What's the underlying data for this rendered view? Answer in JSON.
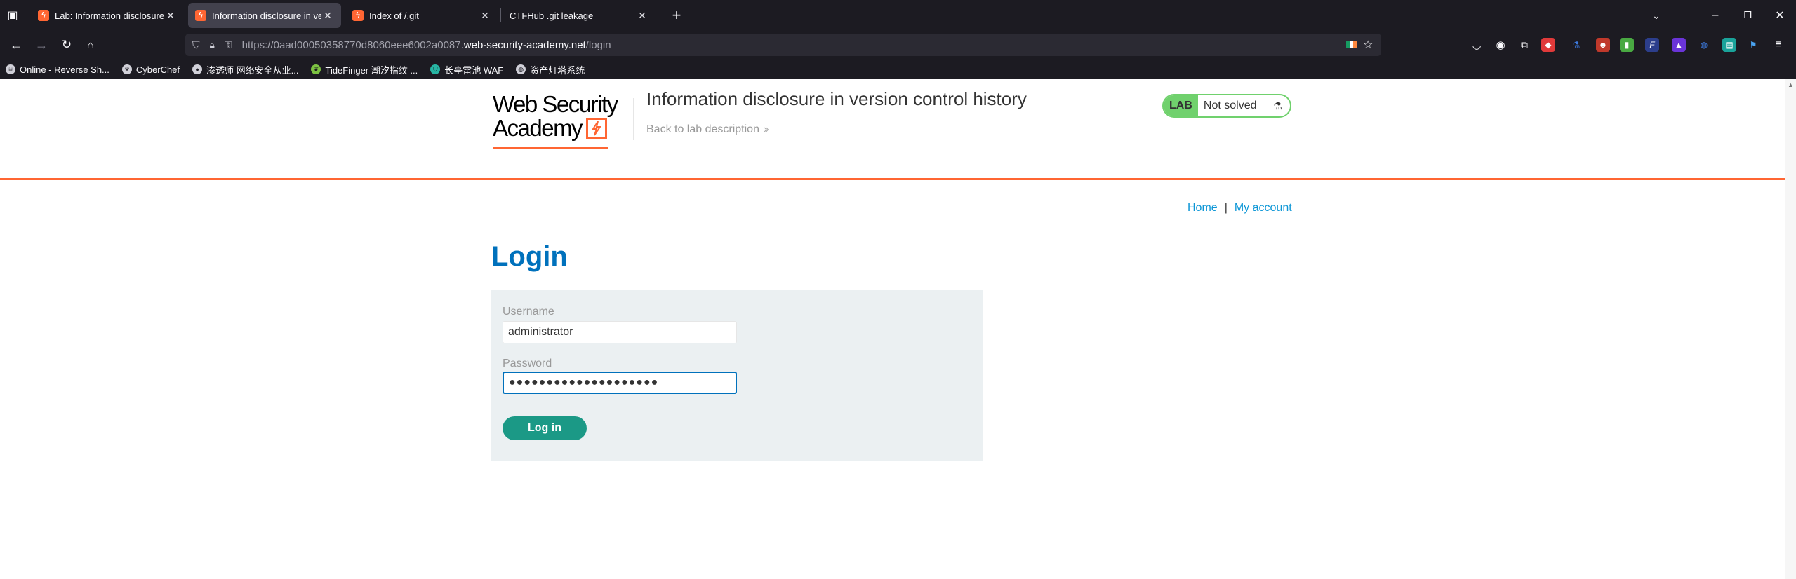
{
  "browser": {
    "tabs": [
      {
        "title": "Lab: Information disclosure in",
        "active": false
      },
      {
        "title": "Information disclosure in ver",
        "active": true
      },
      {
        "title": "Index of /.git",
        "active": false
      },
      {
        "title": "CTFHub .git leakage",
        "active": false
      }
    ],
    "url": {
      "scheme": "https://",
      "subdomain": "0aad00050358770d8060eee6002a0087.",
      "host": "web-security-academy.net",
      "path": "/login"
    },
    "bookmarks": [
      "Online - Reverse Sh...",
      "CyberChef",
      "渗透师 网络安全从业...",
      "TideFinger 潮汐指纹 ...",
      "长亭雷池 WAF",
      "资产灯塔系统"
    ]
  },
  "lab": {
    "logo_line1": "Web Security",
    "logo_line2": "Academy",
    "title": "Information disclosure in version control history",
    "back_link": "Back to lab description",
    "badge_label": "LAB",
    "status": "Not solved"
  },
  "nav": {
    "home": "Home",
    "separator": "|",
    "my_account": "My account"
  },
  "login": {
    "heading": "Login",
    "username_label": "Username",
    "username_value": "administrator",
    "password_label": "Password",
    "password_value": "●●●●●●●●●●●●●●●●●●●●",
    "submit_label": "Log in"
  },
  "colors": {
    "accent_orange": "#ff6633",
    "heading_blue": "#0071bc",
    "button_teal": "#1b9986",
    "status_green": "#70d16d"
  }
}
